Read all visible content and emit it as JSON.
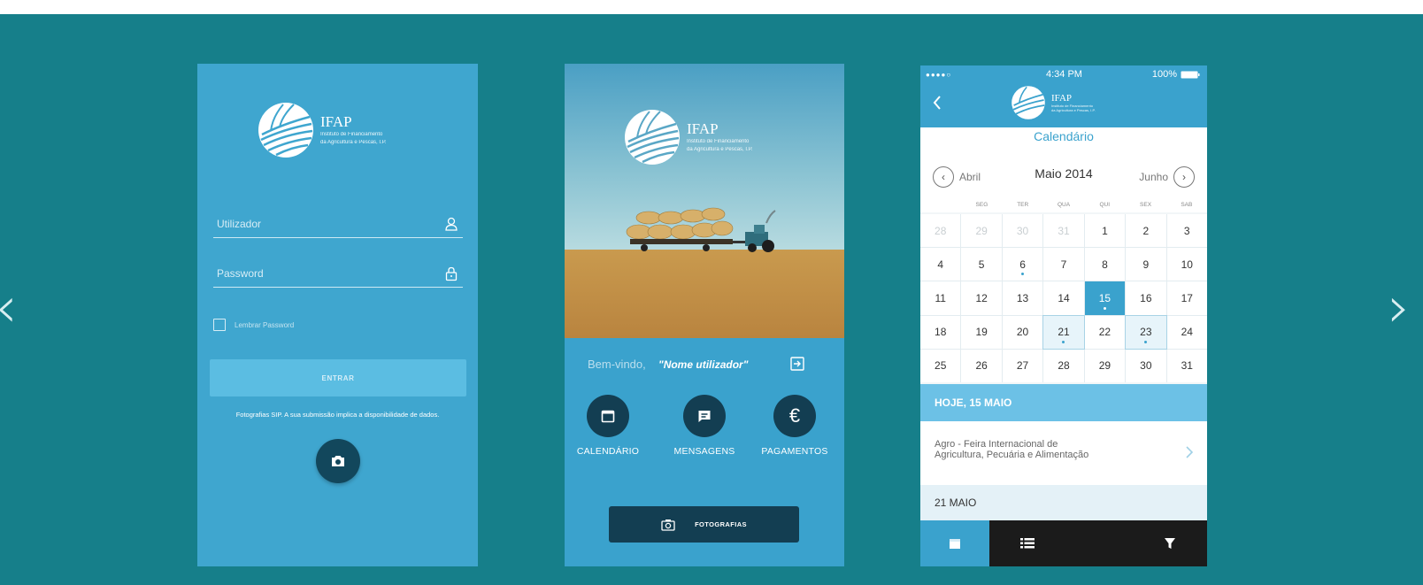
{
  "carousel": {
    "prev_label": "‹",
    "next_label": "›"
  },
  "brand": {
    "name": "IFAP",
    "subtitle_line1": "Instituto de Financiamento",
    "subtitle_line2": "da Agricultura e Pescas, I.P."
  },
  "login": {
    "username_placeholder": "Utilizador",
    "password_placeholder": "Password",
    "remember_label": "Lembrar Password",
    "enter_button": "ENTRAR",
    "photo_note": "Fotografias SIP. A sua submissão implica a disponibilidade de dados."
  },
  "home": {
    "welcome": "Bem-vindo,",
    "user_name": "\"Nome utilizador\"",
    "menu": [
      {
        "label": "CALENDÁRIO",
        "icon": "calendar-icon"
      },
      {
        "label": "MENSAGENS",
        "icon": "message-icon"
      },
      {
        "label": "PAGAMENTOS",
        "icon": "euro-icon",
        "symbol": "€"
      }
    ],
    "photos_button": "FOTOGRAFIAS"
  },
  "calendar": {
    "status": {
      "carrier": "●●●●○",
      "time": "4:34 PM",
      "battery": "100%"
    },
    "title": "Calendário",
    "prev_month": "Abril",
    "current_month": "Maio 2014",
    "next_month": "Junho",
    "weekdays": [
      "SEG",
      "TER",
      "QUA",
      "QUI",
      "SEX",
      "SAB"
    ],
    "days": [
      {
        "d": "28",
        "muted": true
      },
      {
        "d": "29",
        "muted": true
      },
      {
        "d": "30",
        "muted": true
      },
      {
        "d": "31",
        "muted": true
      },
      {
        "d": "1"
      },
      {
        "d": "2"
      },
      {
        "d": "3"
      },
      {
        "d": "4"
      },
      {
        "d": "5"
      },
      {
        "d": "6",
        "dot": true
      },
      {
        "d": "7"
      },
      {
        "d": "8"
      },
      {
        "d": "9"
      },
      {
        "d": "10"
      },
      {
        "d": "11"
      },
      {
        "d": "12"
      },
      {
        "d": "13"
      },
      {
        "d": "14"
      },
      {
        "d": "15",
        "today": true,
        "dot": true
      },
      {
        "d": "16"
      },
      {
        "d": "17"
      },
      {
        "d": "18"
      },
      {
        "d": "19"
      },
      {
        "d": "20"
      },
      {
        "d": "21",
        "event": true,
        "dot": true
      },
      {
        "d": "22"
      },
      {
        "d": "23",
        "event": true,
        "dot": true
      },
      {
        "d": "24"
      },
      {
        "d": "25"
      },
      {
        "d": "26"
      },
      {
        "d": "27"
      },
      {
        "d": "28"
      },
      {
        "d": "29"
      },
      {
        "d": "30"
      },
      {
        "d": "31"
      }
    ],
    "today_header": "HOJE, 15 MAIO",
    "event_line1": "Agro - Feira Internacional de",
    "event_line2": "Agricultura, Pecuária e Alimentação",
    "next_date_header": "21 MAIO"
  },
  "colors": {
    "background": "#167f8a",
    "screen_blue": "#3fa6cf",
    "dark_navy": "#133e52",
    "accent": "#3aa2cd"
  }
}
